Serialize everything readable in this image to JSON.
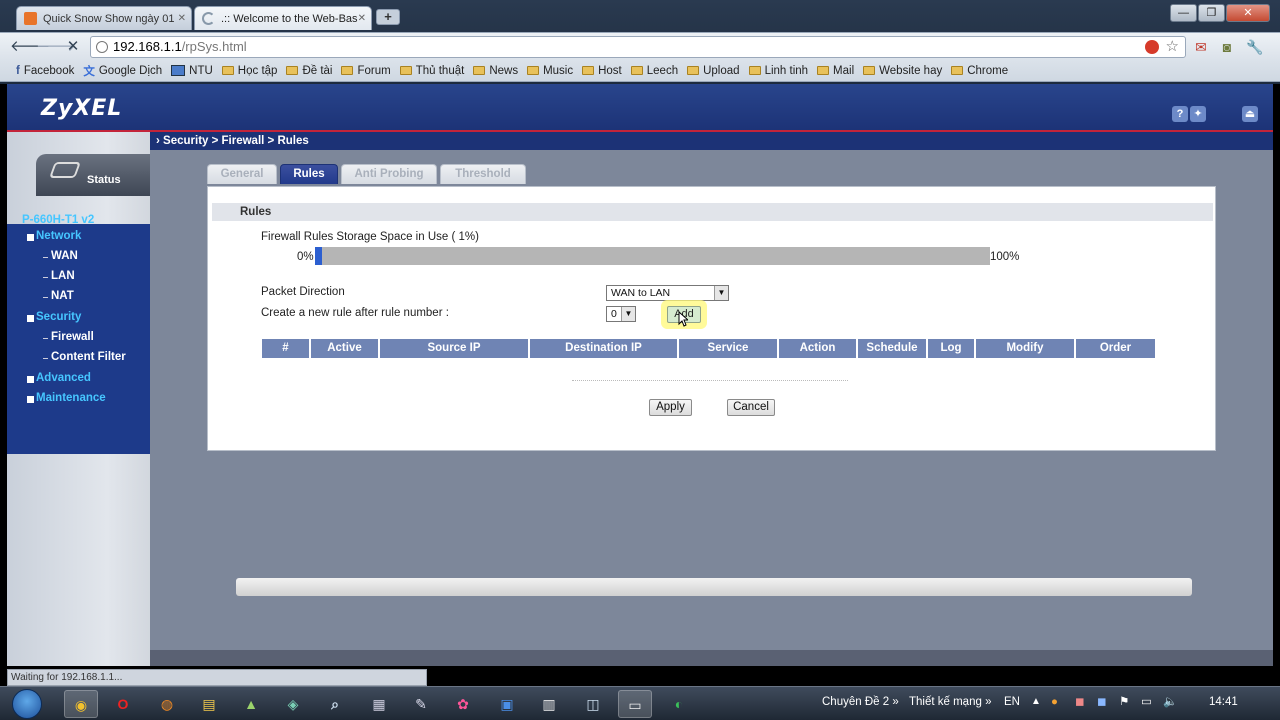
{
  "browser": {
    "tabs": [
      {
        "title": "Quick Snow Show ngày 01",
        "active": false
      },
      {
        "title": ".:: Welcome to the Web-Bas",
        "active": true
      }
    ],
    "new_tab_label": "+",
    "url_host": "192.168.1.1",
    "url_path": "/rpSys.html",
    "bookmarks": [
      {
        "label": "Facebook",
        "icon": "facebook-icon"
      },
      {
        "label": "Google Dịch",
        "icon": "translate-icon"
      },
      {
        "label": "NTU",
        "icon": "image-icon"
      },
      {
        "label": "Học tập",
        "icon": "folder-icon"
      },
      {
        "label": "Đề tài",
        "icon": "folder-icon"
      },
      {
        "label": "Forum",
        "icon": "folder-icon"
      },
      {
        "label": "Thủ thuật",
        "icon": "folder-icon"
      },
      {
        "label": "News",
        "icon": "folder-icon"
      },
      {
        "label": "Music",
        "icon": "folder-icon"
      },
      {
        "label": "Host",
        "icon": "folder-icon"
      },
      {
        "label": "Leech",
        "icon": "folder-icon"
      },
      {
        "label": "Upload",
        "icon": "folder-icon"
      },
      {
        "label": "Linh tinh",
        "icon": "folder-icon"
      },
      {
        "label": "Mail",
        "icon": "folder-icon"
      },
      {
        "label": "Website hay",
        "icon": "folder-icon"
      },
      {
        "label": "Chrome",
        "icon": "folder-icon"
      }
    ],
    "status_text": "Waiting for 192.168.1.1..."
  },
  "router": {
    "logo": "ZyXEL",
    "breadcrumb": "Security > Firewall > Rules",
    "status_tab_label": "Status",
    "model": "P-660H-T1 v2",
    "menu": {
      "network": "Network",
      "wan": "WAN",
      "lan": "LAN",
      "nat": "NAT",
      "security": "Security",
      "firewall": "Firewall",
      "content_filter": "Content Filter",
      "advanced": "Advanced",
      "maintenance": "Maintenance"
    },
    "tabs": {
      "general": "General",
      "rules": "Rules",
      "anti_probing": "Anti Probing",
      "threshold": "Threshold"
    },
    "panel_title": "Rules",
    "storage_label": "Firewall Rules Storage Space in Use  ( 1%)",
    "storage_percent": 1,
    "storage_min": "0%",
    "storage_max": "100%",
    "packet_direction_label": "Packet Direction",
    "packet_direction_value": "WAN to LAN",
    "new_rule_label": "Create a new rule after rule number :",
    "rule_number_value": "0",
    "add_button": "Add",
    "columns": [
      "#",
      "Active",
      "Source IP",
      "Destination IP",
      "Service",
      "Action",
      "Schedule",
      "Log",
      "Modify",
      "Order"
    ],
    "apply_button": "Apply",
    "cancel_button": "Cancel"
  },
  "taskbar": {
    "tray_item_1": "Chuyên Đề 2",
    "tray_item_2": "Thiết kế mạng",
    "language": "EN",
    "clock": "14:41"
  }
}
